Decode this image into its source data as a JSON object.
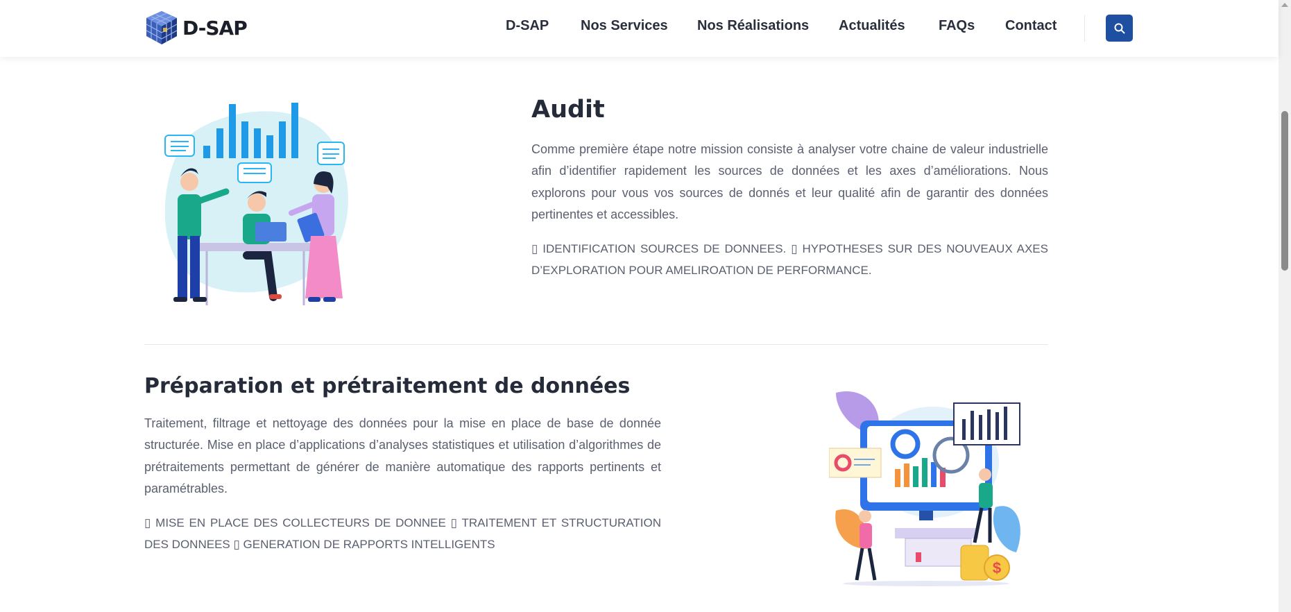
{
  "header": {
    "logo_text": "D-SAP",
    "nav": [
      "D-SAP",
      "Nos Services",
      "Nos Réalisations",
      "Actualités",
      "FAQs",
      "Contact"
    ],
    "search_icon": "search-icon"
  },
  "sections": [
    {
      "title": "Audit",
      "paragraph": "Comme première étape notre mission consiste à analyser votre chaine de valeur industrielle afin d’identifier rapidement les sources de données et les axes d’améliorations. Nous explorons pour vous vos sources de donnés et leur qualité afin de garantir des données pertinentes et accessibles.",
      "list": "▯ IDENTIFICATION SOURCES DE DONNEES. ▯ HYPOTHESES SUR DES NOUVEAUX AXES D’EXPLORATION POUR AMELIROATION DE PERFORMANCE."
    },
    {
      "title": "Préparation et prétraitement de données",
      "paragraph": "Traitement, filtrage et nettoyage des données pour la mise en place de base de donnée structurée. Mise en place d’applications d’analyses statistiques et utilisation d’algorithmes de prétraitements permettant de générer de manière automatique des rapports pertinents et paramétrables.",
      "list": "▯ MISE EN PLACE DES COLLECTEURS DE DONNEE ▯ TRAITEMENT ET STRUCTURATION DES DONNEES ▯ GENERATION DE RAPPORTS INTELLIGENTS"
    }
  ],
  "colors": {
    "accent": "#1e4fa0",
    "heading": "#252b38",
    "text": "#5b6070",
    "illustration_blue": "#2196f3",
    "illustration_teal": "#26c6b2"
  }
}
